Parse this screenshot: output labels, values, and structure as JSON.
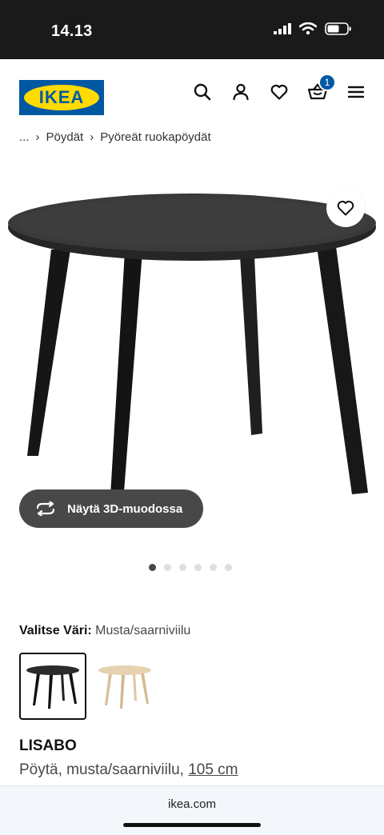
{
  "status_bar": {
    "time": "14.13",
    "icons": [
      "signal-icon",
      "wifi-icon",
      "battery-icon"
    ]
  },
  "header": {
    "logo_text": "IKEA",
    "icons": [
      "search-icon",
      "user-icon",
      "heart-icon",
      "cart-icon",
      "menu-icon"
    ],
    "cart_count": "1"
  },
  "breadcrumb": {
    "ellipsis": "...",
    "items": [
      "Pöydät",
      "Pyöreät ruokapöydät"
    ]
  },
  "product_image": {
    "alt": "LISABO table black"
  },
  "view3d": {
    "label": "Näytä 3D-muodossa"
  },
  "gallery": {
    "total_images": 6,
    "active_index": 0
  },
  "color_selector": {
    "label": "Valitse Väri:",
    "value": "Musta/saarniviilu",
    "options": [
      "black",
      "ash"
    ]
  },
  "product": {
    "name": "LISABO",
    "desc_prefix": "Pöytä, musta/saarniviilu,",
    "size": "105 cm"
  },
  "browser": {
    "url": "ikea.com"
  },
  "colors": {
    "brand_blue": "#0058a3",
    "brand_yellow": "#ffdb00",
    "button_dark": "#484848"
  }
}
